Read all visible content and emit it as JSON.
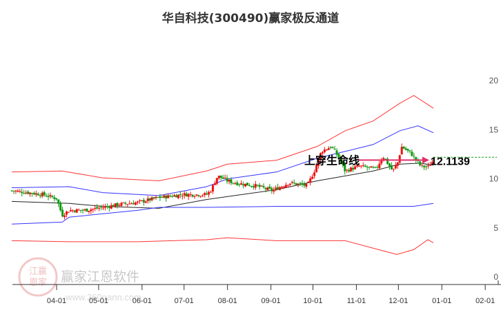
{
  "chart_data": {
    "type": "candlestick",
    "title": "华自科技(300490)赢家极反通道",
    "x_unit": "days from 04-01",
    "x_ticks": [
      {
        "label": "04-01",
        "day": 0
      },
      {
        "label": "05-01",
        "day": 30
      },
      {
        "label": "06-01",
        "day": 61
      },
      {
        "label": "07-01",
        "day": 91
      },
      {
        "label": "08-01",
        "day": 122
      },
      {
        "label": "09-01",
        "day": 153
      },
      {
        "label": "10-01",
        "day": 183
      },
      {
        "label": "11-01",
        "day": 214
      },
      {
        "label": "12-01",
        "day": 244
      },
      {
        "label": "01-01",
        "day": 275
      },
      {
        "label": "02-01",
        "day": 306
      }
    ],
    "y_ticks": [
      0,
      5,
      10,
      15,
      20
    ],
    "ylim": [
      0,
      20
    ],
    "close": [
      [
        -32,
        9.0
      ],
      [
        -20,
        8.8
      ],
      [
        -10,
        8.6
      ],
      [
        0,
        8.2
      ],
      [
        4,
        6.5
      ],
      [
        9,
        7.0
      ],
      [
        20,
        7.0
      ],
      [
        33,
        7.3
      ],
      [
        45,
        7.6
      ],
      [
        58,
        7.8
      ],
      [
        73,
        8.3
      ],
      [
        90,
        8.6
      ],
      [
        107,
        8.6
      ],
      [
        110,
        9.0
      ],
      [
        115,
        10.5
      ],
      [
        122,
        10.0
      ],
      [
        127,
        9.8
      ],
      [
        142,
        9.5
      ],
      [
        154,
        9.0
      ],
      [
        166,
        9.8
      ],
      [
        179,
        9.5
      ],
      [
        184,
        11.0
      ],
      [
        189,
        13.0
      ],
      [
        196,
        13.5
      ],
      [
        201,
        12.5
      ],
      [
        206,
        11.0
      ],
      [
        216,
        11.5
      ],
      [
        228,
        11.2
      ],
      [
        233,
        12.5
      ],
      [
        240,
        11.0
      ],
      [
        244,
        12.0
      ],
      [
        246,
        13.5
      ],
      [
        253,
        12.8
      ],
      [
        260,
        11.5
      ],
      [
        265,
        11.4
      ],
      [
        269,
        12.1
      ]
    ],
    "series": [
      {
        "name": "upper-red",
        "color": "#ff3333",
        "points": [
          [
            -32,
            10.9
          ],
          [
            4,
            11.0
          ],
          [
            33,
            10.3
          ],
          [
            73,
            10.0
          ],
          [
            107,
            11.0
          ],
          [
            122,
            11.7
          ],
          [
            157,
            12.1
          ],
          [
            186,
            13.5
          ],
          [
            206,
            15.1
          ],
          [
            226,
            16.1
          ],
          [
            245,
            17.9
          ],
          [
            255,
            18.7
          ],
          [
            269,
            17.4
          ]
        ]
      },
      {
        "name": "upper-blue",
        "color": "#3333ff",
        "points": [
          [
            -32,
            9.3
          ],
          [
            9,
            9.4
          ],
          [
            33,
            8.8
          ],
          [
            73,
            8.5
          ],
          [
            107,
            9.4
          ],
          [
            122,
            10.2
          ],
          [
            157,
            10.9
          ],
          [
            186,
            12.3
          ],
          [
            206,
            13.0
          ],
          [
            226,
            13.7
          ],
          [
            245,
            15.1
          ],
          [
            258,
            15.6
          ],
          [
            269,
            14.9
          ]
        ]
      },
      {
        "name": "middle-black",
        "color": "#222222",
        "points": [
          [
            -32,
            7.9
          ],
          [
            9,
            7.7
          ],
          [
            33,
            7.4
          ],
          [
            73,
            7.2
          ],
          [
            107,
            8.1
          ],
          [
            157,
            9.1
          ],
          [
            186,
            10.0
          ],
          [
            206,
            10.5
          ],
          [
            226,
            11.0
          ],
          [
            245,
            11.7
          ],
          [
            260,
            11.8
          ],
          [
            269,
            11.6
          ]
        ]
      },
      {
        "name": "lower-blue",
        "color": "#3333ff",
        "points": [
          [
            -32,
            5.6
          ],
          [
            4,
            5.8
          ],
          [
            9,
            6.3
          ],
          [
            58,
            7.0
          ],
          [
            73,
            7.3
          ],
          [
            107,
            7.3
          ],
          [
            157,
            7.4
          ],
          [
            206,
            7.4
          ],
          [
            235,
            7.4
          ],
          [
            255,
            7.4
          ],
          [
            269,
            7.7
          ]
        ]
      },
      {
        "name": "lower-red",
        "color": "#ff3333",
        "points": [
          [
            -32,
            3.9
          ],
          [
            9,
            3.8
          ],
          [
            58,
            3.8
          ],
          [
            107,
            4.0
          ],
          [
            122,
            4.2
          ],
          [
            157,
            3.9
          ],
          [
            206,
            3.9
          ],
          [
            235,
            2.8
          ],
          [
            243,
            2.5
          ],
          [
            255,
            3.0
          ],
          [
            265,
            4.0
          ],
          [
            269,
            3.7
          ]
        ]
      }
    ],
    "annotations": {
      "signal_label": "上穿生命线",
      "price_label": "12.1139",
      "price_level": 12.1139,
      "dashed_level": 12.4
    },
    "watermark": {
      "name": "赢家江恩软件",
      "url": "www.360gann.com",
      "seal": "江赢恩家"
    }
  }
}
